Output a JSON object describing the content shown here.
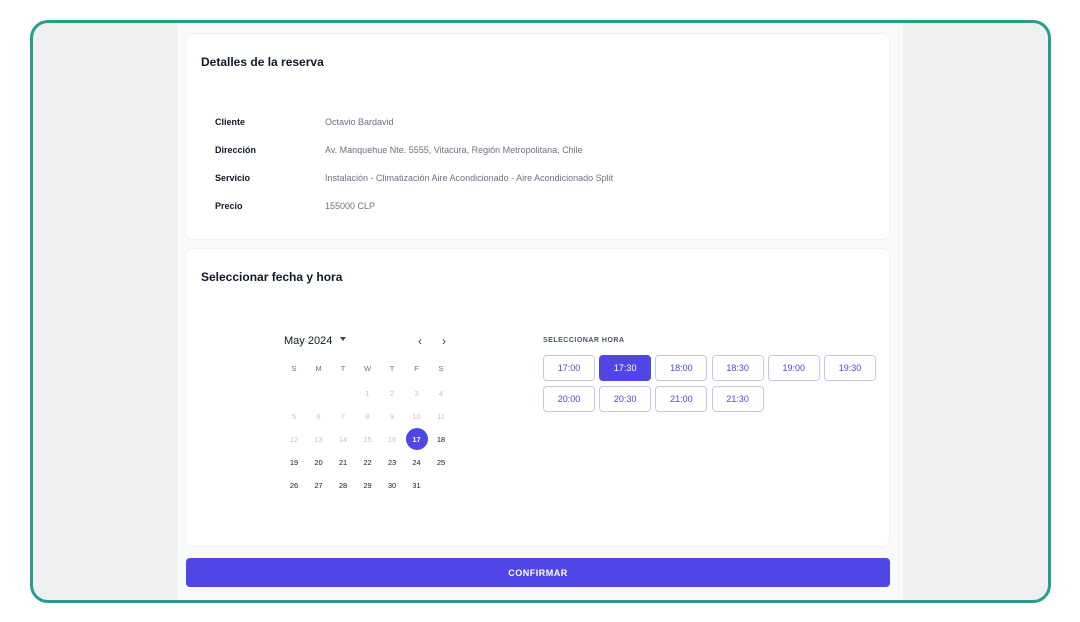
{
  "details": {
    "title": "Detalles de la reserva",
    "rows": [
      {
        "label": "Cliente",
        "value": "Octavio Bardavid"
      },
      {
        "label": "Dirección",
        "value": "Av. Manquehue Nte. 5555, Vitacura, Región Metropolitana, Chile"
      },
      {
        "label": "Servicio",
        "value": "Instalación - Climatización Aire Acondicionado - Aire Acondicionado Split"
      },
      {
        "label": "Precio",
        "value": "155000 CLP"
      }
    ]
  },
  "schedule": {
    "title": "Seleccionar fecha y hora",
    "calendar": {
      "month_label": "May 2024",
      "prev_icon": "chevron-left-icon",
      "next_icon": "chevron-right-icon",
      "weekdays": [
        "S",
        "M",
        "T",
        "W",
        "T",
        "F",
        "S"
      ],
      "first_weekday_index": 3,
      "days_in_month": 31,
      "selected_day": 17,
      "first_enabled_day": 17
    },
    "time_label": "SELECCIONAR HORA",
    "time_slots": [
      "17:00",
      "17:30",
      "18:00",
      "18:30",
      "19:00",
      "19:30",
      "20:00",
      "20:30",
      "21:00",
      "21:30"
    ],
    "selected_slot": "17:30"
  },
  "confirm_label": "CONFIRMAR",
  "colors": {
    "accent": "#4f46e5",
    "frame_border": "#2a9d8a",
    "background": "#eef0f2"
  }
}
